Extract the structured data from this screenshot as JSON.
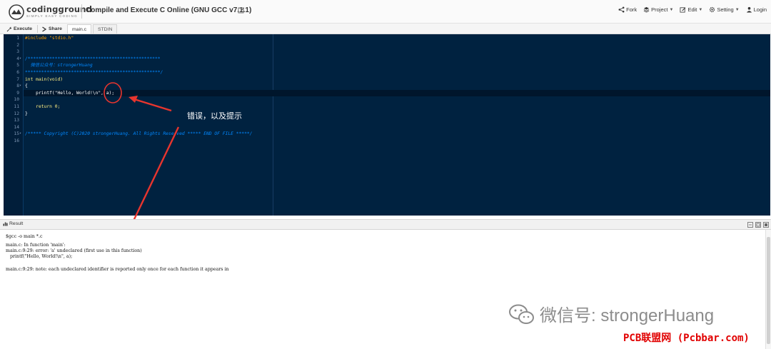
{
  "header": {
    "logo_text": "codingground",
    "logo_tagline": "SIMPLY EASY CODING",
    "title": "Compile and Execute C Online (GNU GCC v7.1.1)",
    "nav": [
      {
        "label": "Fork",
        "icon": "fork-icon"
      },
      {
        "label": "Project",
        "icon": "project-icon"
      },
      {
        "label": "Edit",
        "icon": "edit-icon"
      },
      {
        "label": "Setting",
        "icon": "gear-icon"
      },
      {
        "label": "Login",
        "icon": "user-icon"
      }
    ]
  },
  "toolbar": {
    "execute_label": "Execute",
    "share_label": "Share",
    "tabs": [
      "main.c",
      "STDIN"
    ]
  },
  "editor": {
    "line_numbers": [
      "1",
      "2",
      "3",
      "4",
      "5",
      "6",
      "7",
      "8",
      "9",
      "10",
      "11",
      "12",
      "13",
      "14",
      "15",
      "16"
    ],
    "lines": [
      "#include \"stdio.h\"",
      "",
      "",
      "/*************************************************",
      "  微信公众号：strongerHuang",
      "**************************************************/",
      "int main(void)",
      "{",
      "    printf(\"Hello, World!\\n\", a);",
      "",
      "    return 0;",
      "}",
      "",
      "",
      "/***** Copyright (C)2020 strongerHuang. All Rights Reserved ***** END OF FILE *****/",
      ""
    ]
  },
  "annotation": {
    "label": "错误，以及提示",
    "color": "#e8352e"
  },
  "result": {
    "title": "Result",
    "output_lines": [
      "$gcc -o main *.c",
      "main.c: In function 'main':",
      "main.c:9:29: error: 'a' undeclared (first use in this function)",
      "   printf(\"Hello, World!\\n\", a);",
      "",
      "main.c:9:29: note: each undeclared identifier is reported only once for each function it appears in"
    ]
  },
  "watermarks": {
    "wechat": "微信号: strongerHuang",
    "pcb": "PCB联盟网 (Pcbbar.com)"
  }
}
